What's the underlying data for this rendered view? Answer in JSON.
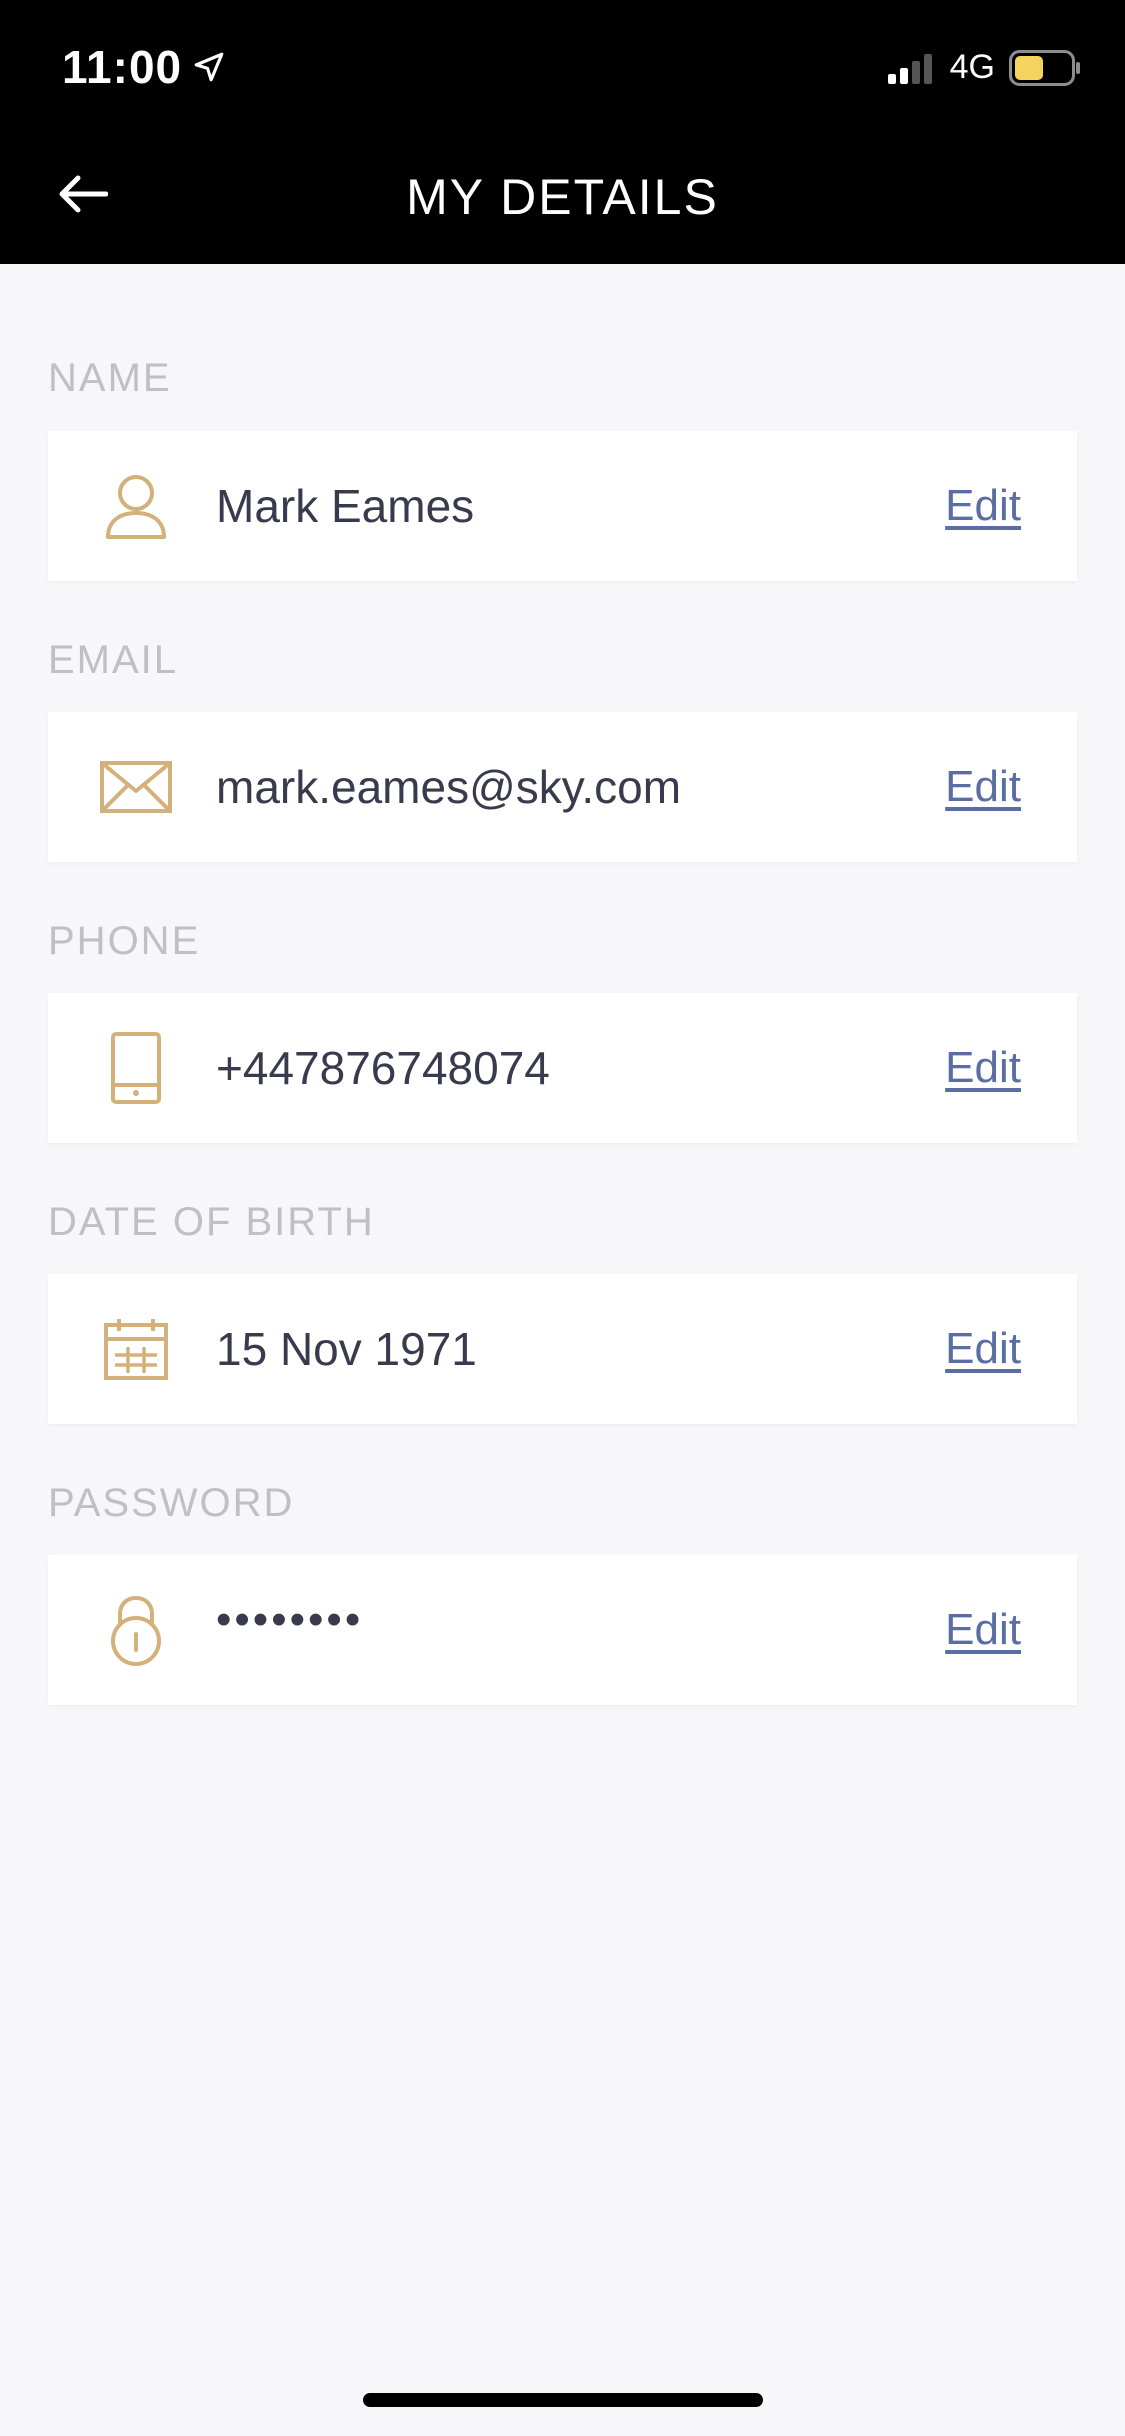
{
  "status_bar": {
    "time": "11:00",
    "network": "4G"
  },
  "header": {
    "title": "MY DETAILS"
  },
  "sections": [
    {
      "label": "NAME",
      "value": "Mark Eames",
      "edit_label": "Edit",
      "icon": "person-icon"
    },
    {
      "label": "EMAIL",
      "value": "mark.eames@sky.com",
      "edit_label": "Edit",
      "icon": "envelope-icon"
    },
    {
      "label": "PHONE",
      "value": "+447876748074",
      "edit_label": "Edit",
      "icon": "phone-icon"
    },
    {
      "label": "DATE OF BIRTH",
      "value": "15 Nov 1971",
      "edit_label": "Edit",
      "icon": "calendar-icon"
    },
    {
      "label": "PASSWORD",
      "value": "••••••••",
      "edit_label": "Edit",
      "icon": "lock-icon"
    }
  ],
  "colors": {
    "accent_gold": "#d4b07a",
    "link_blue": "#5a6ea3",
    "battery_yellow": "#f4d35e"
  }
}
